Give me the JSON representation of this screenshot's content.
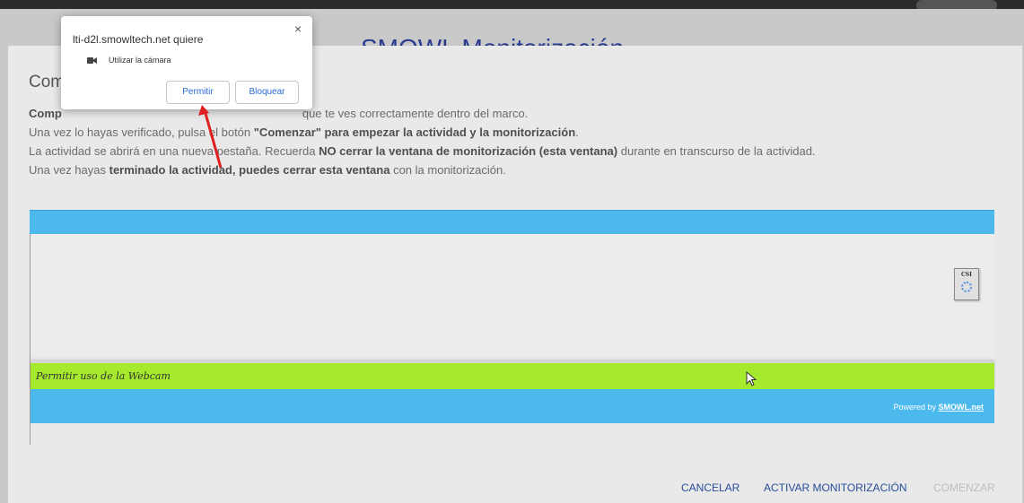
{
  "background": {
    "title": "SMOWL Monitorización"
  },
  "modal": {
    "title": "Com",
    "instructions": {
      "line1_prefix": "Comp",
      "line1_rest": "que te ves correctamente dentro del marco.",
      "line2_a": "Una vez lo hayas verificado, pulsa el botón ",
      "line2_b": "\"Comenzar\" para empezar la actividad y la monitorización",
      "line2_c": ".",
      "line3_a": "La actividad se abrirá en una nueva pestaña. Recuerda ",
      "line3_b": "NO cerrar la ventana de monitorización (esta ventana)",
      "line3_c": " durante en transcurso de la actividad.",
      "line4_a": "Una vez hayas ",
      "line4_b": "terminado la actividad, puedes cerrar esta ventana",
      "line4_c": " con la monitorización."
    },
    "webcam": {
      "csi_label": "CSI",
      "status_text": "Permitir uso de la Webcam",
      "powered_prefix": "Powered by ",
      "powered_link": "SMOWL.net"
    },
    "buttons": {
      "cancel": "CANCELAR",
      "activate": "ACTIVAR MONITORIZACIÓN",
      "start": "COMENZAR"
    }
  },
  "popup": {
    "title": "lti-d2l.smowltech.net quiere",
    "permission": "Utilizar la cámara",
    "allow": "Permitir",
    "block": "Bloquear",
    "close": "×"
  },
  "colors": {
    "blue_bar": "#4cb9ed",
    "green_bar": "#a5ea2c",
    "link_blue": "#2a4c9a",
    "arrow_red": "#e02020"
  }
}
